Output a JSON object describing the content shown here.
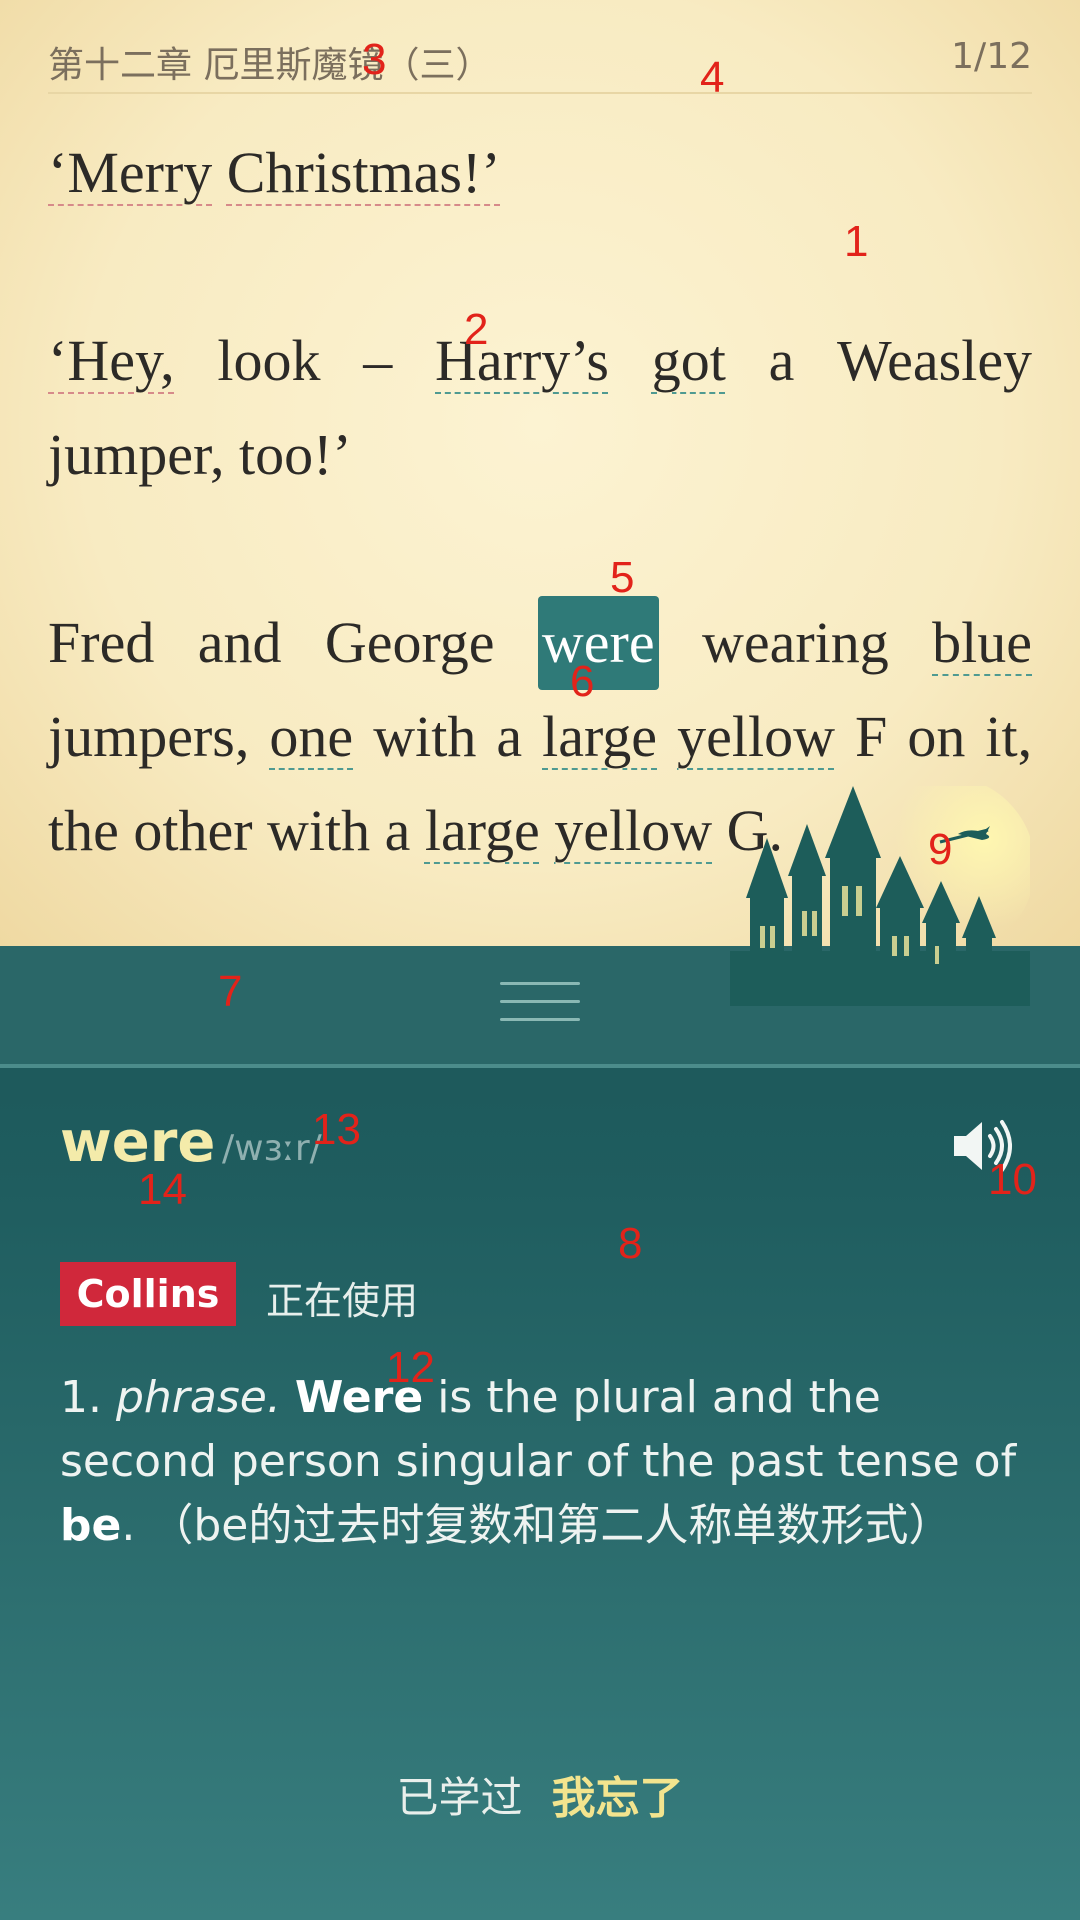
{
  "reader": {
    "chapter_title": "第十二章 厄里斯魔镜（三）",
    "page_counter": "1/12",
    "paragraphs": {
      "p1": {
        "w1": "‘Merry",
        "w2": "Christmas!’"
      },
      "p2": {
        "w1": "‘Hey,",
        "w2": "look",
        "w3": "–",
        "w4": "Harry’s",
        "w5": "got",
        "w6": "a",
        "w7": "Weasley",
        "w8": "jumper,",
        "w9": "too!’"
      },
      "p3": {
        "w1": "Fred",
        "w2": "and",
        "w3": "George",
        "w4": "were",
        "w5": "wearing",
        "w6": "blue",
        "w7": "jumpers,",
        "w8": "one",
        "w9": "with",
        "w10": "a",
        "w11": "large",
        "w12": "yellow",
        "w13": "F",
        "w14": "on",
        "w15": "it,",
        "w16": "the",
        "w17": "other",
        "w18": "with",
        "w19": "a",
        "w20": "large",
        "w21": "yellow",
        "w22": "G."
      }
    }
  },
  "dictionary": {
    "headword": "were",
    "phonetic": "/wɜːr/",
    "speaker_icon": "speaker-icon",
    "source_badge": "Collins",
    "source_status": "正在使用",
    "definition": {
      "number": "1.",
      "pos": "phrase.",
      "bold_word": "Were",
      "text_a": " is the plural and the second person singular of the past tense of ",
      "bold_word2": "be",
      "text_b": ". （be的过去时复数和第二人称单数形式）"
    },
    "actions": {
      "learned": "已学过",
      "forgot": "我忘了"
    }
  },
  "annotations": {
    "a1": "1",
    "a2": "2",
    "a3": "3",
    "a4": "4",
    "a5": "5",
    "a6": "6",
    "a7": "7",
    "a8": "8",
    "a9": "9",
    "a10": "10",
    "a12": "12",
    "a13": "13",
    "a14": "14"
  },
  "colors": {
    "page_bg": "#f8ebc2",
    "panel_bg": "#1f5d5f",
    "selection": "#2f7a78",
    "headword": "#f4ebaa",
    "collins_red": "#d0283b",
    "forgot": "#f3e48e",
    "annotation": "#e2231a"
  }
}
